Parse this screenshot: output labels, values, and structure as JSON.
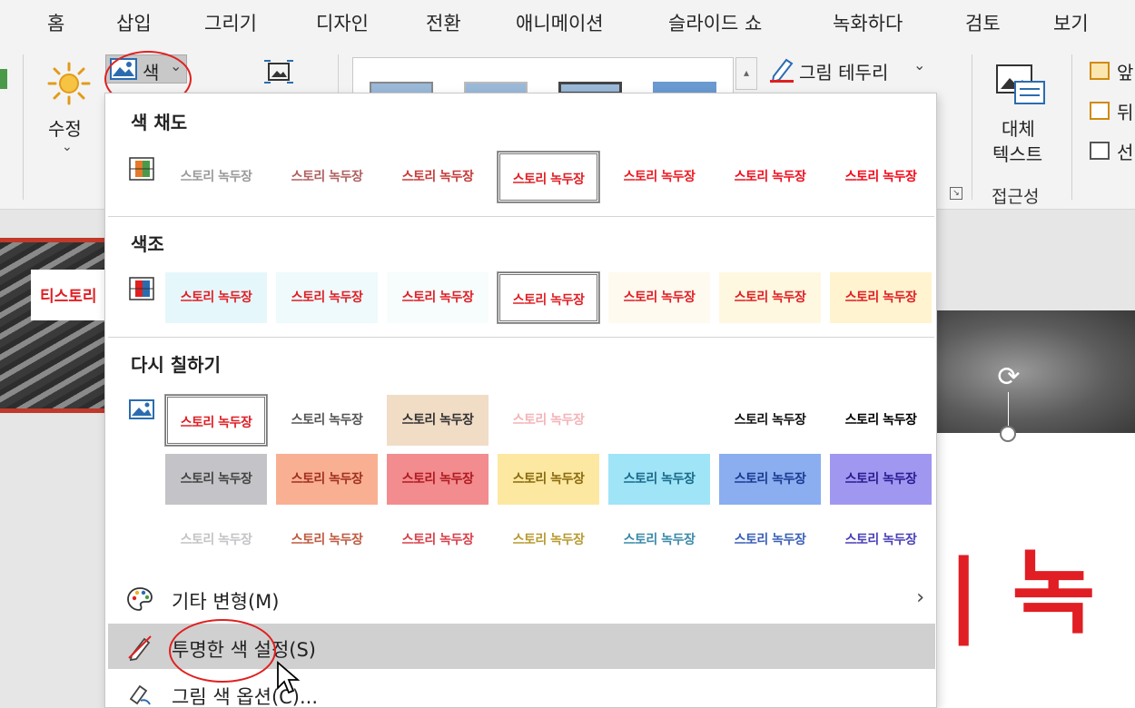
{
  "menu_tabs": [
    "홈",
    "삽입",
    "그리기",
    "디자인",
    "전환",
    "애니메이션",
    "슬라이드 쇼",
    "녹화하다",
    "검토",
    "보기"
  ],
  "ribbon": {
    "correct_label": "수정",
    "color_label": "색",
    "border_label": "그림 테두리",
    "alt_text_line1": "대체",
    "alt_text_line2": "텍스트",
    "accessibility_label": "접근성",
    "partial_right": [
      "앞",
      "뒤",
      "선"
    ]
  },
  "dropdown": {
    "saturation_title": "색 채도",
    "tone_title": "색조",
    "recolor_title": "다시 칠하기",
    "swatch_text": "스토리 녹두장",
    "saturation_row": [
      {
        "bg": "#ffffff",
        "fg": "#9a9a9a"
      },
      {
        "bg": "#ffffff",
        "fg": "#b06060"
      },
      {
        "bg": "#ffffff",
        "fg": "#c83a3a"
      },
      {
        "bg": "#ffffff",
        "fg": "#e01e24",
        "selected": true
      },
      {
        "bg": "#ffffff",
        "fg": "#ee1a22"
      },
      {
        "bg": "#ffffff",
        "fg": "#f01020"
      },
      {
        "bg": "#ffffff",
        "fg": "#f30a1a"
      }
    ],
    "tone_row": [
      {
        "bg": "#e6f7fb",
        "fg": "#e01e24"
      },
      {
        "bg": "#eefafc",
        "fg": "#e01e24"
      },
      {
        "bg": "#f7fcfd",
        "fg": "#e01e24"
      },
      {
        "bg": "#ffffff",
        "fg": "#e01e24",
        "selected": true
      },
      {
        "bg": "#fffaf0",
        "fg": "#e01e24"
      },
      {
        "bg": "#fff8e0",
        "fg": "#e01e24"
      },
      {
        "bg": "#fff3d0",
        "fg": "#e01e24"
      }
    ],
    "recolor_row1": [
      {
        "bg": "#ffffff",
        "fg": "#e01e24",
        "selected": true
      },
      {
        "bg": "#ffffff",
        "fg": "#555555"
      },
      {
        "bg": "#f1dcc6",
        "fg": "#333333"
      },
      {
        "bg": "#ffffff",
        "fg": "#f4b4b8"
      },
      {
        "bg": "#ffffff",
        "fg": "#ffffff"
      },
      {
        "bg": "#ffffff",
        "fg": "#111111"
      },
      {
        "bg": "#ffffff",
        "fg": "#000000"
      }
    ],
    "recolor_row2": [
      {
        "bg": "#c4c4c8",
        "fg": "#444444"
      },
      {
        "bg": "#f9b092",
        "fg": "#a03020"
      },
      {
        "bg": "#f28c8e",
        "fg": "#b01a20"
      },
      {
        "bg": "#fce8a0",
        "fg": "#8a6a10"
      },
      {
        "bg": "#a0e4f8",
        "fg": "#1a6a88"
      },
      {
        "bg": "#8aaef0",
        "fg": "#1a3a90"
      },
      {
        "bg": "#a098f0",
        "fg": "#2a1a90"
      }
    ],
    "recolor_row3": [
      {
        "bg": "#ffffff",
        "fg": "#c4c4c8"
      },
      {
        "bg": "#ffffff",
        "fg": "#c05a40"
      },
      {
        "bg": "#ffffff",
        "fg": "#d8404a"
      },
      {
        "bg": "#ffffff",
        "fg": "#b89a30"
      },
      {
        "bg": "#ffffff",
        "fg": "#3a8aaa"
      },
      {
        "bg": "#ffffff",
        "fg": "#3a60b8"
      },
      {
        "bg": "#ffffff",
        "fg": "#4a40b8"
      }
    ],
    "more_variations": "기타 변형(M)",
    "set_transparent": "투명한 색 설정(S)",
    "picture_color_options": "그림 색 옵션(C)..."
  },
  "slide": {
    "thumb_text": "티스토리",
    "big_text": "| 녹"
  },
  "colors": {
    "accent_red": "#e01e24",
    "annotation_red": "#e02020",
    "hover_gray": "#d0d0d0"
  }
}
